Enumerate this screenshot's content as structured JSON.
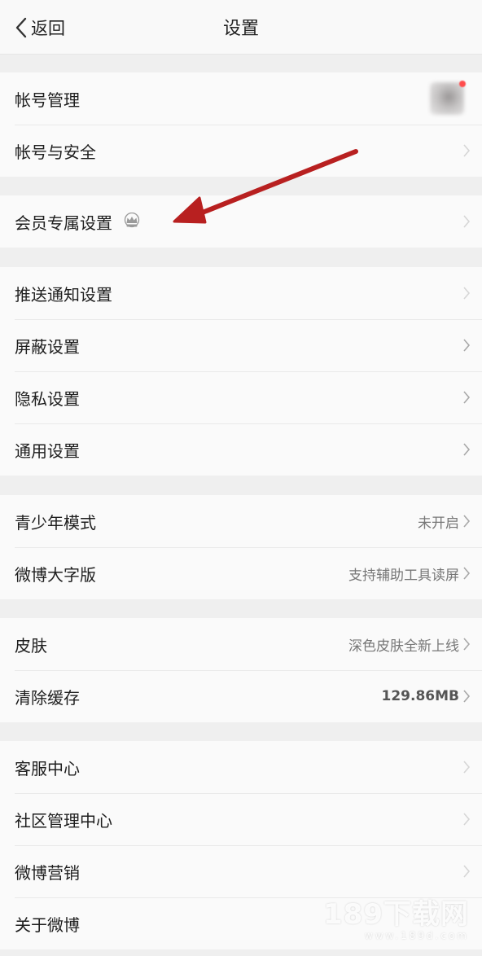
{
  "nav": {
    "back_label": "返回",
    "title": "设置"
  },
  "groups": [
    {
      "rows": [
        {
          "label": "帐号管理"
        },
        {
          "label": "帐号与安全"
        }
      ]
    },
    {
      "rows": [
        {
          "label": "会员专属设置"
        }
      ]
    },
    {
      "rows": [
        {
          "label": "推送通知设置"
        },
        {
          "label": "屏蔽设置"
        },
        {
          "label": "隐私设置"
        },
        {
          "label": "通用设置"
        }
      ]
    },
    {
      "rows": [
        {
          "label": "青少年模式",
          "value": "未开启"
        },
        {
          "label": "微博大字版",
          "value": "支持辅助工具读屏"
        }
      ]
    },
    {
      "rows": [
        {
          "label": "皮肤",
          "value": "深色皮肤全新上线"
        },
        {
          "label": "清除缓存",
          "value": "129.86MB"
        }
      ]
    },
    {
      "rows": [
        {
          "label": "客服中心"
        },
        {
          "label": "社区管理中心"
        },
        {
          "label": "微博营销"
        },
        {
          "label": "关于微博"
        }
      ]
    }
  ],
  "watermark": {
    "main": "189下载网",
    "sub": "www.189d.com"
  },
  "colors": {
    "annotation_arrow": "#b82020",
    "background": "#efefef",
    "cell": "#fafafa"
  }
}
